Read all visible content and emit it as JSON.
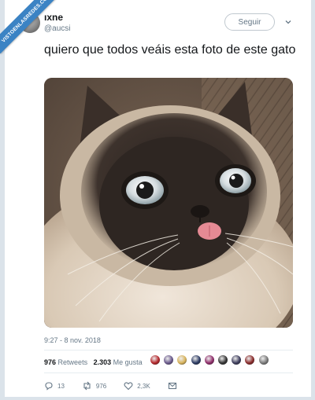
{
  "watermark": {
    "text": "VISTOENLASREDES.COM"
  },
  "user": {
    "name": "ıxne",
    "handle": "@aucsi"
  },
  "follow": {
    "label": "Seguir"
  },
  "tweet": {
    "text": "quiero que todos veáis esta foto de este gato"
  },
  "meta": {
    "timestamp": "9:27 - 8 nov. 2018"
  },
  "stats": {
    "retweets_count": "976",
    "retweets_label": "Retweets",
    "likes_count": "2.303",
    "likes_label": "Me gusta"
  },
  "likers": [
    "#b4262a",
    "#6a5a8c",
    "#d8b35a",
    "#2c3b63",
    "#8f2d6a",
    "#333333",
    "#3d3d5c",
    "#8a2b2b",
    "#7a7a7a"
  ],
  "actions": {
    "replies": "13",
    "retweets": "976",
    "likes": "2,3K"
  },
  "colors": {
    "accent": "#3b83c4",
    "muted": "#657786",
    "text": "#14171a"
  }
}
